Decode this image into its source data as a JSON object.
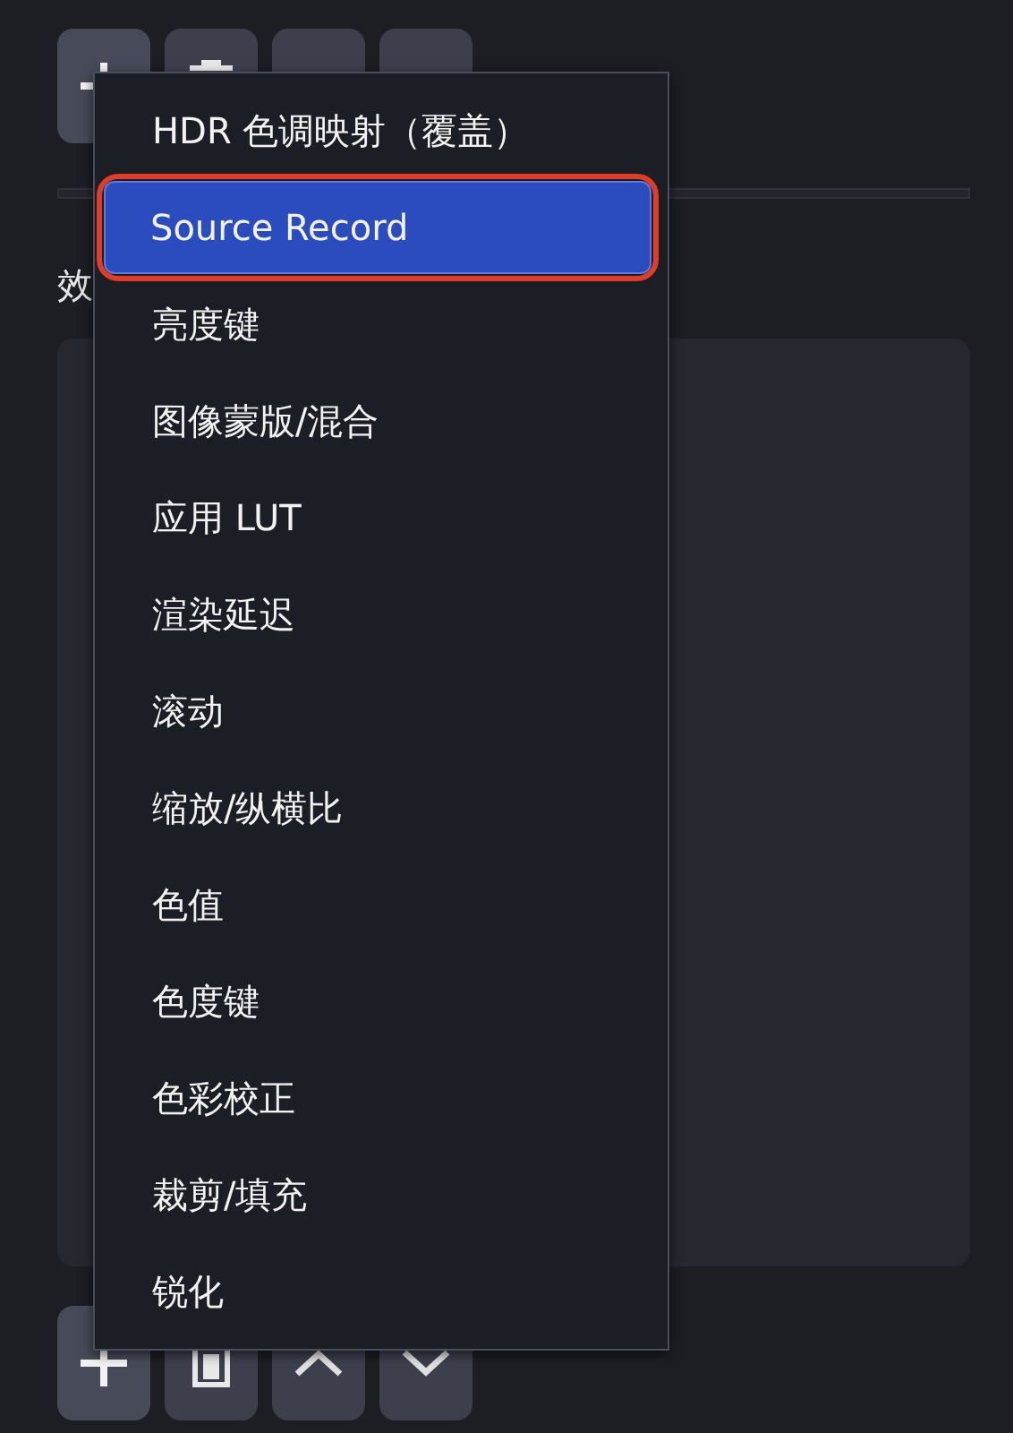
{
  "top_toolbar": [
    {
      "kind": "add"
    },
    {
      "kind": "remove"
    },
    {
      "kind": "blank"
    },
    {
      "kind": "blank"
    }
  ],
  "section_label": "效",
  "bottom_toolbar": [
    {
      "kind": "add"
    },
    {
      "kind": "remove"
    },
    {
      "kind": "up"
    },
    {
      "kind": "down"
    }
  ],
  "menu": {
    "items": [
      {
        "label": "HDR 色调映射（覆盖）",
        "selected": false,
        "circled": false
      },
      {
        "label": "Source Record",
        "selected": true,
        "circled": true
      },
      {
        "label": "亮度键",
        "selected": false,
        "circled": false
      },
      {
        "label": "图像蒙版/混合",
        "selected": false,
        "circled": false
      },
      {
        "label": "应用 LUT",
        "selected": false,
        "circled": false
      },
      {
        "label": "渲染延迟",
        "selected": false,
        "circled": false
      },
      {
        "label": "滚动",
        "selected": false,
        "circled": false
      },
      {
        "label": "缩放/纵横比",
        "selected": false,
        "circled": false
      },
      {
        "label": "色值",
        "selected": false,
        "circled": false
      },
      {
        "label": "色度键",
        "selected": false,
        "circled": false
      },
      {
        "label": "色彩校正",
        "selected": false,
        "circled": false
      },
      {
        "label": "裁剪/填充",
        "selected": false,
        "circled": false
      },
      {
        "label": "锐化",
        "selected": false,
        "circled": false
      }
    ]
  }
}
